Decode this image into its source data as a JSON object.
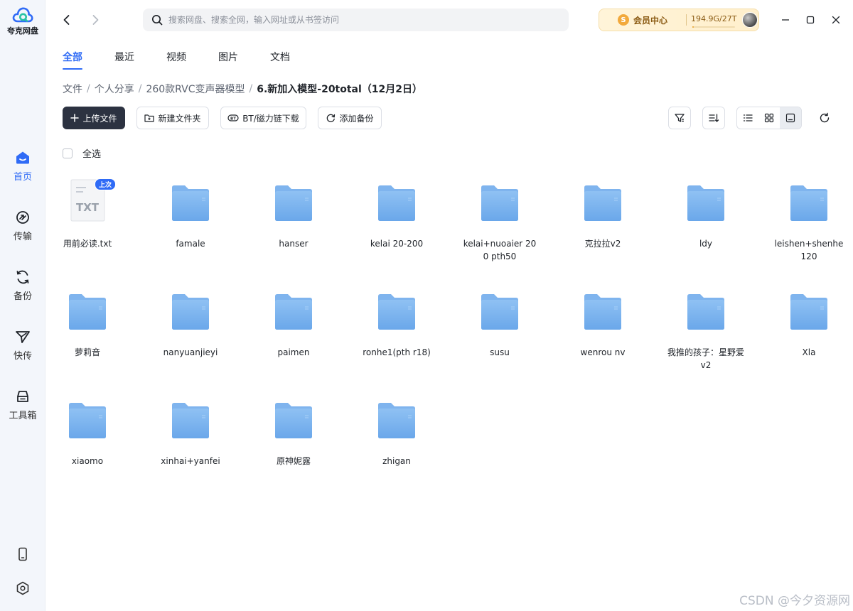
{
  "app": {
    "name": "夸克网盘"
  },
  "colors": {
    "accent": "#2f6bf6",
    "folder": "#7fb4ee",
    "vip_gold": "#f2a93b"
  },
  "sidebar": {
    "items": [
      {
        "label": "首页",
        "icon": "home-icon",
        "active": true
      },
      {
        "label": "传输",
        "icon": "transfer-icon",
        "active": false
      },
      {
        "label": "备份",
        "icon": "backup-icon",
        "active": false
      },
      {
        "label": "快传",
        "icon": "quick-send-icon",
        "active": false
      },
      {
        "label": "工具箱",
        "icon": "toolbox-icon",
        "active": false
      }
    ],
    "bottom_icons": [
      "phone-icon",
      "settings-icon"
    ]
  },
  "search": {
    "placeholder": "搜索网盘、搜索全网，输入网址或从书签访问",
    "value": ""
  },
  "vip": {
    "badge": "S",
    "label": "会员中心",
    "storage": "194.9G/27T",
    "usage_fraction": 0.007
  },
  "tabs": [
    {
      "label": "全部",
      "active": true
    },
    {
      "label": "最近",
      "active": false
    },
    {
      "label": "视频",
      "active": false
    },
    {
      "label": "图片",
      "active": false
    },
    {
      "label": "文档",
      "active": false
    }
  ],
  "breadcrumb": [
    "文件",
    "个人分享",
    "260款RVC变声器模型",
    "6.新加入模型-20total（12月2日）"
  ],
  "toolbar": {
    "upload": "上传文件",
    "new_folder": "新建文件夹",
    "bt_download": "BT/磁力链下载",
    "add_backup": "添加备份",
    "active_view": "thumbnail"
  },
  "select_all": "全选",
  "files": [
    {
      "name": "用前必读.txt",
      "type": "txt",
      "badge": "上次",
      "icon_label": "TXT"
    },
    {
      "name": "famale",
      "type": "folder"
    },
    {
      "name": "hanser",
      "type": "folder"
    },
    {
      "name": "kelai 20-200",
      "type": "folder"
    },
    {
      "name": "kelai+nuoaier 200 pth50",
      "type": "folder"
    },
    {
      "name": "克拉拉v2",
      "type": "folder"
    },
    {
      "name": "ldy",
      "type": "folder"
    },
    {
      "name": "leishen+shenhe 120",
      "type": "folder"
    },
    {
      "name": "萝莉音",
      "type": "folder"
    },
    {
      "name": "nanyuanjieyi",
      "type": "folder"
    },
    {
      "name": "paimen",
      "type": "folder"
    },
    {
      "name": "ronhe1(pth r18)",
      "type": "folder"
    },
    {
      "name": "susu",
      "type": "folder"
    },
    {
      "name": "wenrou nv",
      "type": "folder"
    },
    {
      "name": "我推的孩子：星野爱v2",
      "type": "folder"
    },
    {
      "name": "Xla",
      "type": "folder"
    },
    {
      "name": "xiaomo",
      "type": "folder"
    },
    {
      "name": "xinhai+yanfei",
      "type": "folder"
    },
    {
      "name": "原神妮露",
      "type": "folder"
    },
    {
      "name": "zhigan",
      "type": "folder"
    }
  ],
  "watermark": "CSDN @今夕资源网"
}
